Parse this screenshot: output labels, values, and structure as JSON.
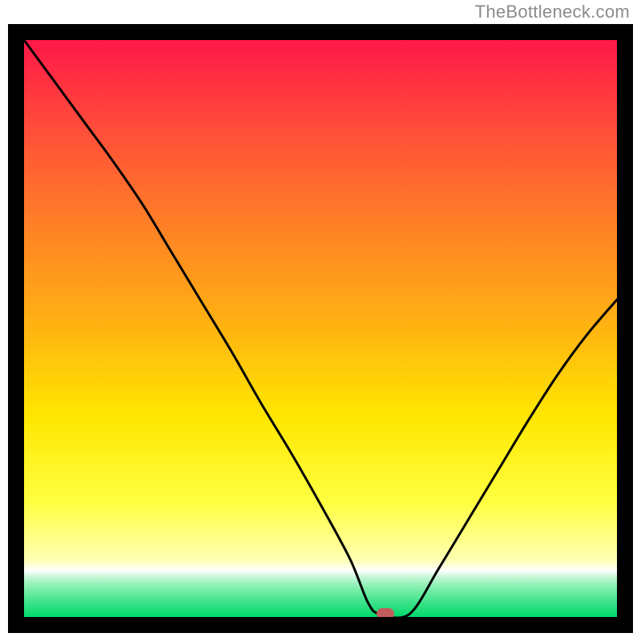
{
  "attribution": "TheBottleneck.com",
  "chart_data": {
    "type": "line",
    "title": "",
    "xlabel": "",
    "ylabel": "",
    "xlim": [
      0,
      100
    ],
    "ylim": [
      0,
      100
    ],
    "grid": false,
    "x": [
      0,
      5,
      10,
      15,
      20,
      25,
      30,
      35,
      40,
      45,
      50,
      55,
      58,
      60,
      65,
      70,
      75,
      80,
      85,
      90,
      95,
      100
    ],
    "values": [
      100,
      93,
      86,
      79,
      71.5,
      63,
      54.5,
      46,
      37,
      28.5,
      19.5,
      10,
      2.5,
      0.5,
      0.5,
      8.5,
      17,
      25.5,
      34,
      42,
      49,
      55
    ],
    "marker": {
      "x": 61,
      "y": 0.5,
      "color": "#c25d5d"
    },
    "gradient_stops": [
      {
        "offset": 0,
        "color": "#ff1848"
      },
      {
        "offset": 0.15,
        "color": "#ff4c3a"
      },
      {
        "offset": 0.32,
        "color": "#ff8026"
      },
      {
        "offset": 0.5,
        "color": "#ffb411"
      },
      {
        "offset": 0.65,
        "color": "#ffe600"
      },
      {
        "offset": 0.8,
        "color": "#ffff40"
      },
      {
        "offset": 0.9,
        "color": "#ffffb0"
      },
      {
        "offset": 0.92,
        "color": "#fefffd"
      },
      {
        "offset": 0.93,
        "color": "#c8f7d8"
      },
      {
        "offset": 0.95,
        "color": "#80eead"
      },
      {
        "offset": 0.975,
        "color": "#3ce389"
      },
      {
        "offset": 1.0,
        "color": "#00d86b"
      }
    ]
  }
}
